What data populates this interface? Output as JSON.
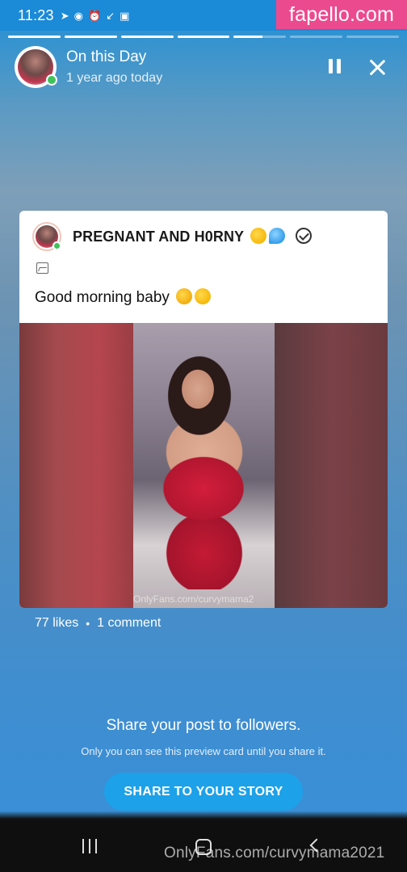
{
  "status_bar": {
    "time": "11:23",
    "icons": [
      "telegram-icon",
      "messenger-icon",
      "alarm-icon",
      "missed-call-icon",
      "image-icon"
    ]
  },
  "watermark_top": "fapello.com",
  "progress": {
    "segments": 7,
    "filled": 4,
    "current_fraction": 0.55
  },
  "header": {
    "title": "On this Day",
    "subtitle": "1 year ago today"
  },
  "post": {
    "author_name": "PREGNANT AND H0RNY",
    "author_emojis": [
      "kissing-face-emoji",
      "sweat-droplets-emoji"
    ],
    "verified": true,
    "text": "Good morning baby",
    "text_emojis": [
      "smiling-face-with-hearts-emoji",
      "kissing-face-emoji"
    ],
    "image_watermark": "OnlyFans.com/curvymama2"
  },
  "stats": {
    "likes": "77 likes",
    "separator": "•",
    "comments": "1 comment"
  },
  "share": {
    "title": "Share your post to followers.",
    "note": "Only you can see this preview card until you share it.",
    "button_label": "SHARE TO YOUR STORY"
  },
  "watermark_bottom": "OnlyFans.com/curvymama2021",
  "colors": {
    "accent": "#1da1e8",
    "watermark_pink": "#ec4a8f",
    "online": "#3fc35a"
  }
}
